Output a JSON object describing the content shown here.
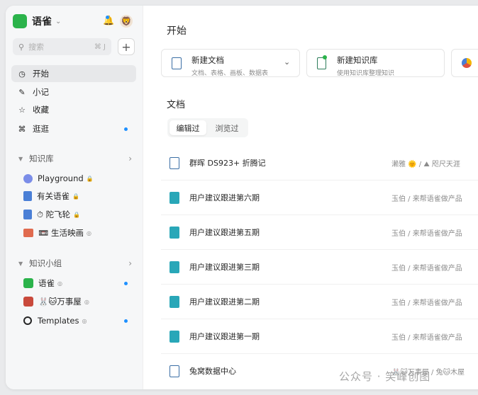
{
  "app": {
    "title": "语雀"
  },
  "sidebar": {
    "search_placeholder": "搜索",
    "search_shortcut": "⌘ J",
    "add_label": "+",
    "nav": [
      {
        "label": "开始",
        "icon": "clock-icon",
        "active": true
      },
      {
        "label": "小记",
        "icon": "feather-icon"
      },
      {
        "label": "收藏",
        "icon": "star-icon"
      },
      {
        "label": "逛逛",
        "icon": "grid-icon",
        "badge": true
      }
    ],
    "kb_section": {
      "title": "知识库"
    },
    "knowledge_bases": [
      {
        "label": "Playground",
        "locked": true,
        "color": "#7b8de8"
      },
      {
        "label": "有关语雀",
        "locked": true,
        "color": "#4a7fd6"
      },
      {
        "label": "⏱ 陀飞轮",
        "locked": true,
        "color": "#4a7fd6"
      },
      {
        "label": "📼 生活映画",
        "color": "#e06b4f"
      }
    ],
    "group_section": {
      "title": "知识小组"
    },
    "groups": [
      {
        "label": "语雀",
        "badge": true
      },
      {
        "label": "🐰🐱万事屋"
      },
      {
        "label": "Templates",
        "badge": true
      }
    ]
  },
  "main": {
    "start_title": "开始",
    "cards": [
      {
        "title": "新建文档",
        "subtitle": "文档、表格、画板、数据表"
      },
      {
        "title": "新建知识库",
        "subtitle": "使用知识库整理知识"
      }
    ],
    "docs_title": "文档",
    "tabs": [
      "编辑过",
      "浏览过"
    ],
    "docs": [
      {
        "title": "群晖 DS923+ 折腾记",
        "path": "濑雅 🌞 / ⛰ 咫尺天涯",
        "type": "doc"
      },
      {
        "title": "用户建议跟进第六期",
        "path": "玉伯 / 来帮语雀做产品",
        "type": "board"
      },
      {
        "title": "用户建议跟进第五期",
        "path": "玉伯 / 来帮语雀做产品",
        "type": "board"
      },
      {
        "title": "用户建议跟进第三期",
        "path": "玉伯 / 来帮语雀做产品",
        "type": "board"
      },
      {
        "title": "用户建议跟进第二期",
        "path": "玉伯 / 来帮语雀做产品",
        "type": "board"
      },
      {
        "title": "用户建议跟进第一期",
        "path": "玉伯 / 来帮语雀做产品",
        "type": "board"
      },
      {
        "title": "兔窝数据中心",
        "path": "🐰🐱万事屋 / 兔🐱木屋",
        "type": "doc"
      }
    ]
  },
  "watermark": "公众号 · 笑峰创图"
}
